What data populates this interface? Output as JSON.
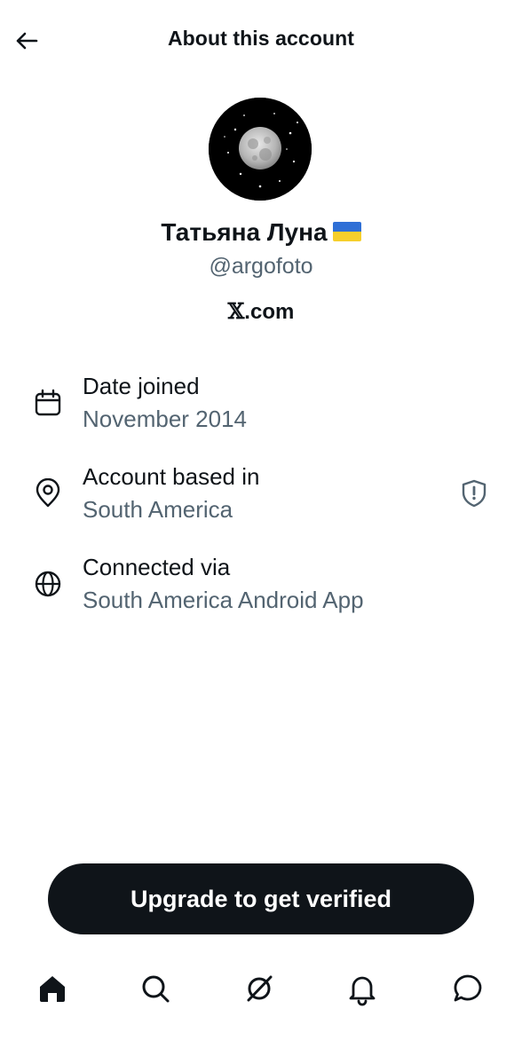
{
  "header": {
    "title": "About this account"
  },
  "profile": {
    "name": "Татьяна Луна",
    "handle": "@argofoto",
    "domain_mark": "𝕏",
    "domain_suffix": ".com"
  },
  "details": [
    {
      "label": "Date joined",
      "value": "November 2014",
      "icon": "calendar-icon"
    },
    {
      "label": "Account based in",
      "value": "South America",
      "icon": "location-pin-icon",
      "trailing_icon": "shield-alert-icon"
    },
    {
      "label": "Connected via",
      "value": "South America Android App",
      "icon": "globe-icon"
    }
  ],
  "cta": {
    "label": "Upgrade to get verified"
  },
  "tabbar": {
    "items": [
      "home-icon",
      "search-icon",
      "grok-icon",
      "notifications-icon",
      "messages-icon"
    ]
  },
  "colors": {
    "text": "#0f1419",
    "secondary": "#536471",
    "cta_bg": "#0f1419"
  }
}
